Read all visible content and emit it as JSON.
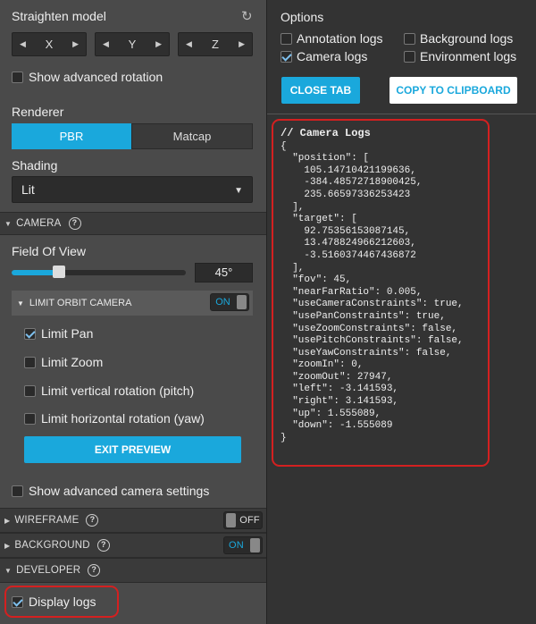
{
  "left": {
    "straighten_title": "Straighten model",
    "axes": [
      {
        "label": "X"
      },
      {
        "label": "Y"
      },
      {
        "label": "Z"
      }
    ],
    "show_advanced_rotation": "Show advanced rotation",
    "renderer_title": "Renderer",
    "renderer_options": [
      "PBR",
      "Matcap"
    ],
    "shading_title": "Shading",
    "shading_value": "Lit",
    "camera_section": "CAMERA",
    "fov_title": "Field Of View",
    "fov_value": "45°",
    "fov_fraction": 0.27,
    "limit_orbit_label": "LIMIT ORBIT CAMERA",
    "limit_orbit_toggle": "ON",
    "limit_options": [
      {
        "label": "Limit Pan",
        "checked": true
      },
      {
        "label": "Limit Zoom",
        "checked": false
      },
      {
        "label": "Limit vertical rotation (pitch)",
        "checked": false
      },
      {
        "label": "Limit horizontal rotation (yaw)",
        "checked": false
      }
    ],
    "exit_preview": "EXIT PREVIEW",
    "show_advanced_camera": "Show advanced camera settings",
    "wireframe_section": "WIREFRAME",
    "wireframe_toggle": "OFF",
    "background_section": "BACKGROUND",
    "background_toggle": "ON",
    "developer_section": "DEVELOPER",
    "display_logs": "Display logs"
  },
  "right": {
    "options_title": "Options",
    "options": [
      {
        "label": "Annotation logs",
        "checked": false
      },
      {
        "label": "Background logs",
        "checked": false
      },
      {
        "label": "Camera logs",
        "checked": true
      },
      {
        "label": "Environment logs",
        "checked": false
      }
    ],
    "close_tab": "CLOSE TAB",
    "copy_clipboard": "COPY TO CLIPBOARD",
    "log_header": "// Camera Logs",
    "log_body": "{\n  \"position\": [\n    105.14710421199636,\n    -384.48572718900425,\n    235.66597336253423\n  ],\n  \"target\": [\n    92.75356153087145,\n    13.478824966212603,\n    -3.5160374467436872\n  ],\n  \"fov\": 45,\n  \"nearFarRatio\": 0.005,\n  \"useCameraConstraints\": true,\n  \"usePanConstraints\": true,\n  \"useZoomConstraints\": false,\n  \"usePitchConstraints\": false,\n  \"useYawConstraints\": false,\n  \"zoomIn\": 0,\n  \"zoomOut\": 27947,\n  \"left\": -3.141593,\n  \"right\": 3.141593,\n  \"up\": 1.555089,\n  \"down\": -1.555089\n}"
  },
  "colors": {
    "accent": "#1aa8dc",
    "highlight_red": "#d42020"
  }
}
